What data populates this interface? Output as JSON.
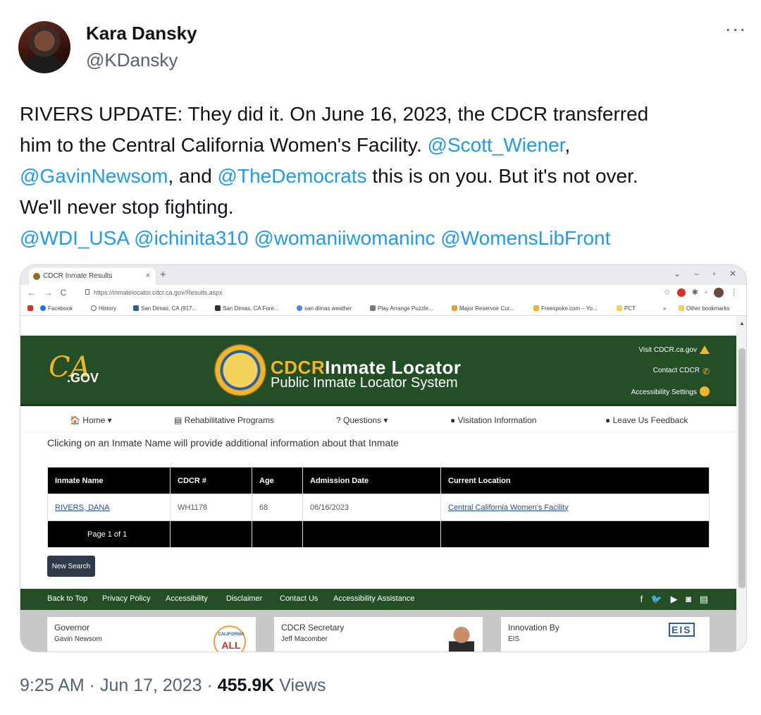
{
  "author": {
    "name": "Kara Dansky",
    "handle": "@KDansky"
  },
  "more_label": "···",
  "tweet": {
    "line1": "RIVERS UPDATE: They did it. On June 16, 2023, the CDCR transferred",
    "line2_a": "him to the Central California Women's Facility. ",
    "line2_m": "@Scott_Wiener",
    "line2_b": ",",
    "line3_m1": "@GavinNewsom",
    "line3_a": ", and ",
    "line3_m2": "@TheDemocrats",
    "line3_b": " this is on you. But it's not over.",
    "line4": "We'll never stop fighting.",
    "mentions": [
      "@WDI_USA",
      "@ichinita310",
      "@womaniiwomaninc",
      "@WomensLibFront"
    ]
  },
  "browser": {
    "tab_title": "CDCR Inmate Results",
    "tab_close": "×",
    "new_tab": "+",
    "window_controls": "⌄ – ▫ ✕",
    "nav": "← → C",
    "url": "https://inmatelocator.cdcr.ca.gov/Results.aspx",
    "bookmarks": [
      "Facebook",
      "History",
      "San Dimas, CA (917...",
      "San Dimas, CA Fore...",
      "san dimas weather",
      "Play Arrange Puzzle...",
      "Major Reservoir Cur...",
      "Freespoke.com – Yo...",
      "PCT",
      "»",
      "Other bookmarks"
    ]
  },
  "site": {
    "ca_letters": "CA",
    "ca_gov": ".GOV",
    "title_accent": "CDCR",
    "title_rest": "Inmate Locator",
    "subtitle": "Public Inmate Locator System",
    "header_links": [
      "Visit CDCR.ca.gov",
      "Contact CDCR",
      "Accessibility Settings"
    ],
    "nav": [
      "Home ▾",
      "Rehabilitative Programs",
      "? Questions ▾",
      "Visitation Information",
      "Leave Us Feedback"
    ],
    "instruction": "Clicking on an Inmate Name will provide additional information about that Inmate",
    "table": {
      "headers": [
        "Inmate Name",
        "CDCR #",
        "Age",
        "Admission Date",
        "Current Location"
      ],
      "row": [
        "RIVERS, DANA",
        "WH1178",
        "68",
        "06/16/2023",
        "Central California Women's Facility"
      ],
      "pager": "Page 1 of 1"
    },
    "new_search": "New Search",
    "footer_links": [
      "Back to Top",
      "Privacy Policy",
      "Accessibility",
      "Disclaimer",
      "Contact Us",
      "Accessibility Assistance"
    ],
    "social": "f 🐦 ▶ ◙ ▤",
    "footer_boxes": [
      {
        "title": "Governor",
        "name": "Gavin Newsom",
        "logo_top": "CALIFORNIA",
        "logo_main": "ALL"
      },
      {
        "title": "CDCR Secretary",
        "name": "Jeff Macomber"
      },
      {
        "title": "Innovation By",
        "name": "EIS",
        "logo": "EIS"
      }
    ]
  },
  "meta": {
    "time": "9:25 AM · Jun 17, 2023 · ",
    "views_count": "455.9K",
    "views_label": " Views"
  },
  "colors": {
    "mention": "#1d9bf0",
    "site_green": "#244f26",
    "gold": "#f1b52a"
  }
}
